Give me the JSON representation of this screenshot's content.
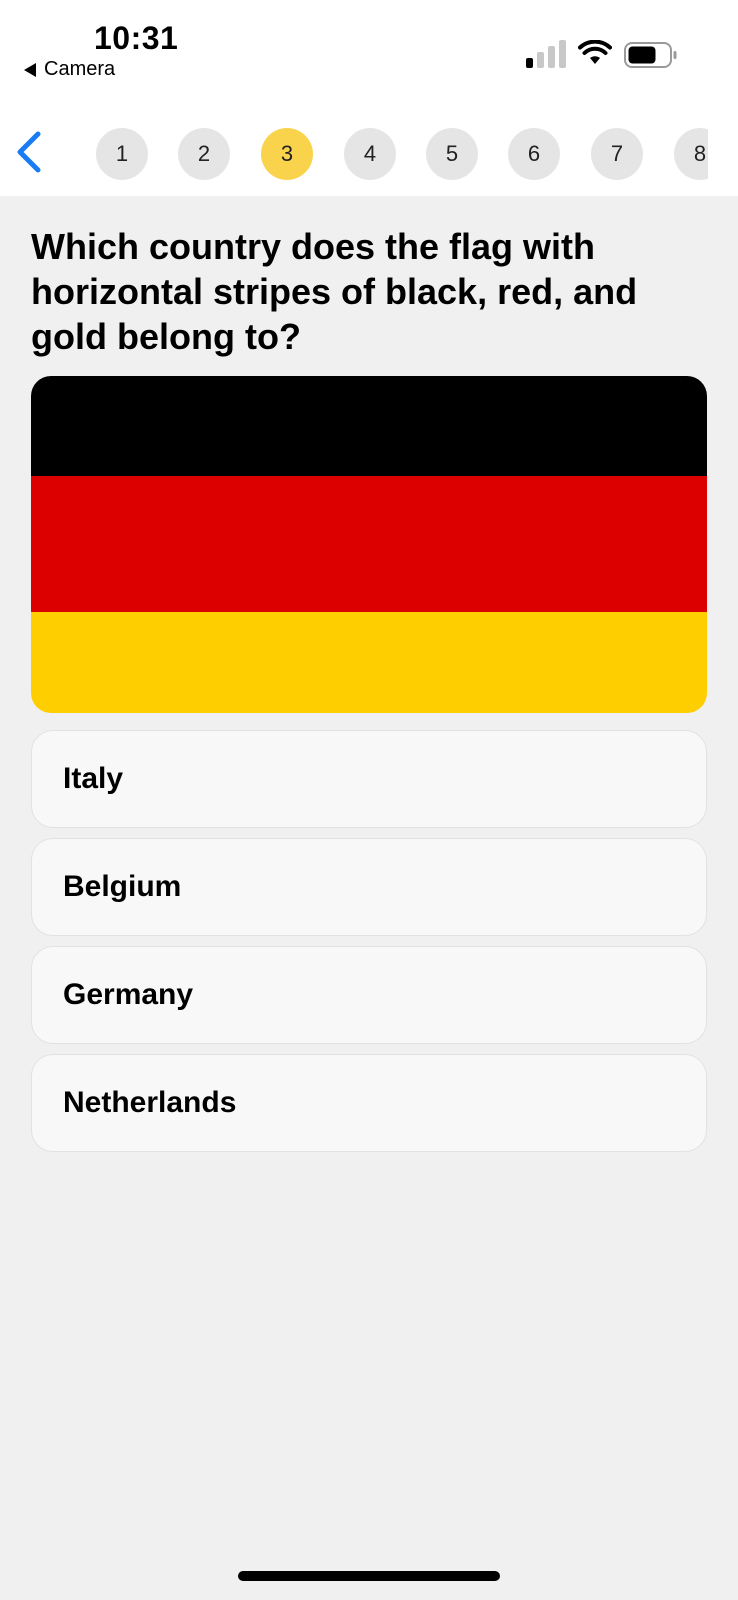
{
  "status_bar": {
    "time": "10:31",
    "back_app": "Camera"
  },
  "steps": [
    {
      "label": "1",
      "state": "default"
    },
    {
      "label": "2",
      "state": "default"
    },
    {
      "label": "3",
      "state": "current"
    },
    {
      "label": "4",
      "state": "default"
    },
    {
      "label": "5",
      "state": "default"
    },
    {
      "label": "6",
      "state": "default"
    },
    {
      "label": "7",
      "state": "default"
    },
    {
      "label": "8",
      "state": "default"
    }
  ],
  "question": {
    "text": "Which country does the flag with horizontal stripes of black, red, and gold belong to?"
  },
  "flag": {
    "stripes": [
      {
        "color": "#000000"
      },
      {
        "color": "#dd0000"
      },
      {
        "color": "#ffce00"
      }
    ]
  },
  "options": [
    {
      "label": "Italy"
    },
    {
      "label": "Belgium"
    },
    {
      "label": "Germany"
    },
    {
      "label": "Netherlands"
    }
  ],
  "colors": {
    "accent": "#1a7cf2",
    "current_step": "#fad34d",
    "step_bg": "#e5e5e5",
    "page_bg": "#f0f0f0"
  }
}
